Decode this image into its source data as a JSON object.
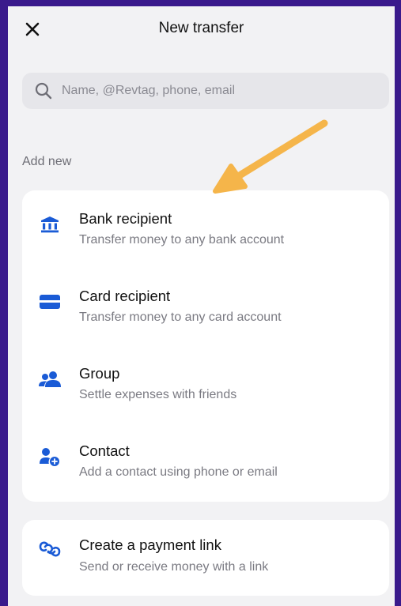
{
  "header": {
    "title": "New transfer",
    "close_icon": "close-icon"
  },
  "search": {
    "placeholder": "Name, @Revtag, phone, email",
    "icon": "search-icon"
  },
  "section": {
    "label": "Add new"
  },
  "add_new_items": [
    {
      "icon": "bank-icon",
      "title": "Bank recipient",
      "description": "Transfer money to any bank account"
    },
    {
      "icon": "card-icon",
      "title": "Card recipient",
      "description": "Transfer money to any card account"
    },
    {
      "icon": "group-icon",
      "title": "Group",
      "description": "Settle expenses with friends"
    },
    {
      "icon": "add-contact-icon",
      "title": "Contact",
      "description": "Add a contact using phone or email"
    }
  ],
  "payment_link": {
    "icon": "link-icon",
    "title": "Create a payment link",
    "description": "Send or receive money with a link"
  },
  "colors": {
    "frame": "#3a1a8c",
    "accent": "#1a5bd6",
    "arrow": "#f5b54a",
    "background": "#f2f2f4"
  }
}
